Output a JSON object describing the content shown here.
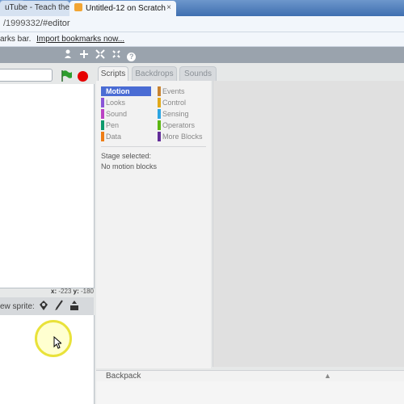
{
  "browser": {
    "tabs": [
      {
        "label": "uTube - Teach the"
      },
      {
        "label": "Untitled-12 on Scratch"
      }
    ],
    "tab_close": "×",
    "url_prefix": "/1999332",
    "url_suffix": "/#editor",
    "bookmarks_text": "arks bar.",
    "import_bookmarks": "Import bookmarks now..."
  },
  "toolbar": {
    "icons": [
      "duplicate-icon",
      "cut-icon",
      "grow-icon",
      "shrink-icon",
      "help-icon"
    ],
    "help_glyph": "?"
  },
  "stage": {
    "x_label": "x:",
    "x_value": "-223",
    "y_label": "y:",
    "y_value": "-180"
  },
  "sprites": {
    "new_sprite_label": "ew sprite:"
  },
  "editor_tabs": [
    {
      "label": "Scripts",
      "active": true
    },
    {
      "label": "Backdrops",
      "active": false
    },
    {
      "label": "Sounds",
      "active": false
    }
  ],
  "categories": {
    "left": [
      {
        "label": "Motion",
        "color": "#4a6cd4",
        "active": true
      },
      {
        "label": "Looks",
        "color": "#8a55d7"
      },
      {
        "label": "Sound",
        "color": "#bb42c3"
      },
      {
        "label": "Pen",
        "color": "#0e9a6c"
      },
      {
        "label": "Data",
        "color": "#ee7d16"
      }
    ],
    "right": [
      {
        "label": "Events",
        "color": "#c88330"
      },
      {
        "label": "Control",
        "color": "#e1a91a"
      },
      {
        "label": "Sensing",
        "color": "#2ca5e2"
      },
      {
        "label": "Operators",
        "color": "#5cb712"
      },
      {
        "label": "More Blocks",
        "color": "#632d99"
      }
    ]
  },
  "palette": {
    "stage_selected": "Stage selected:",
    "no_blocks": "No motion blocks"
  },
  "backpack": {
    "label": "Backpack",
    "arrow": "▲"
  }
}
